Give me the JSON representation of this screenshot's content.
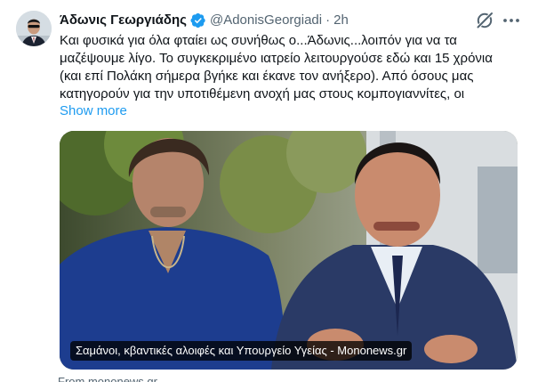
{
  "tweet": {
    "author": {
      "display_name": "Άδωνις Γεωργιάδης",
      "handle": "@AdonisGeorgiadi",
      "verified": true
    },
    "separator": "·",
    "time": "2h",
    "text_lines": [
      "Και φυσικά για όλα φταίει ως συνήθως ο...Άδωνις...λοιπόν για να τα",
      "μαζέψουμε λίγο. Το συγκεκριμένο ιατρείο λειτουργούσε εδώ και 15 χρόνια",
      "(και επί Πολάκη σήμερα βγήκε και έκανε τον ανήξερο). Από όσους μας",
      "κατηγορούν για την υποτιθέμενη ανοχή μας στους κομπογιαννίτες, οι"
    ],
    "show_more": "Show more",
    "card": {
      "caption": "Σαμάνοι, κβαντικές αλοιφές και Υπουργείο Υγείας - Mononews.gr",
      "source": "From mononews.gr"
    },
    "icons": {
      "verified": "verified-badge-icon",
      "grok": "grok-icon",
      "more": "more-dots-icon"
    },
    "colors": {
      "accent": "#1d9bf0",
      "text": "#0f1419",
      "secondary_text": "#536471"
    }
  }
}
